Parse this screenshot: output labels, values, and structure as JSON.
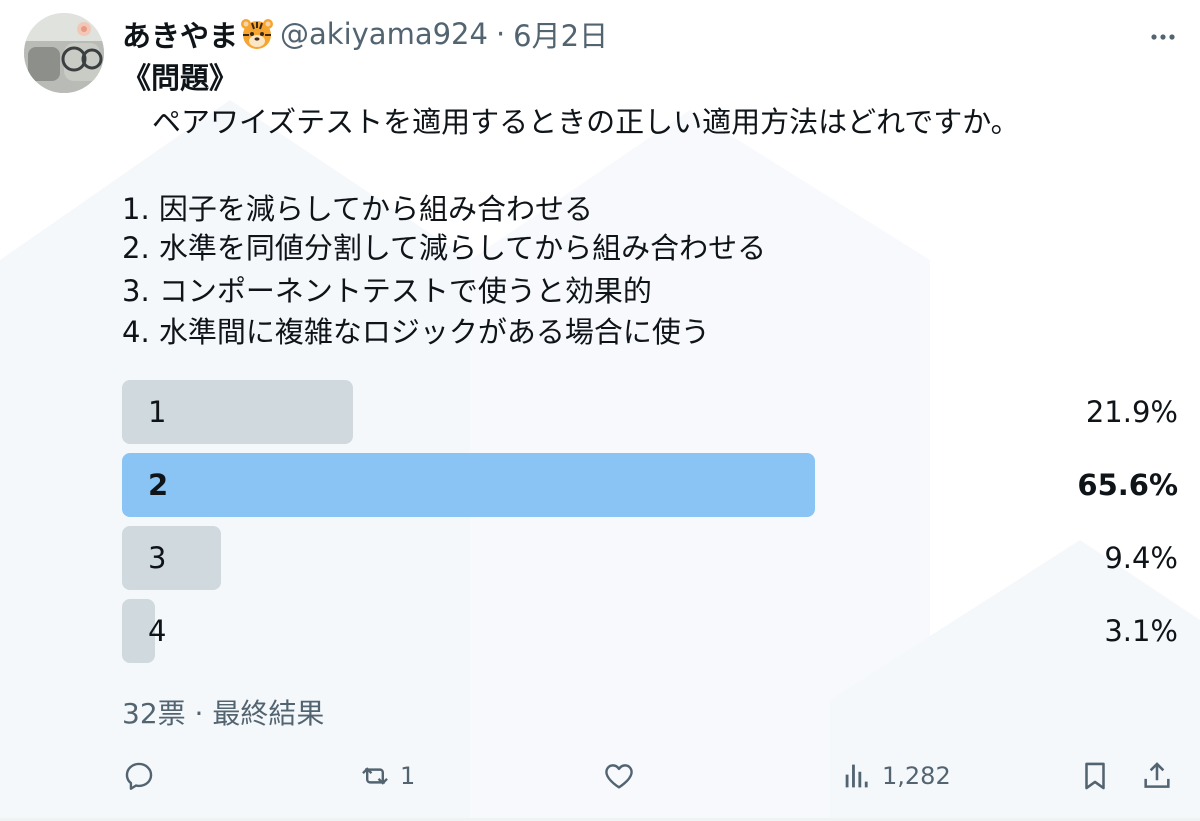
{
  "tweet": {
    "display_name": "あきやま",
    "emoji": "tiger",
    "handle": "@akiyama924",
    "separator": "·",
    "date": "6月2日",
    "heading": "《問題》",
    "question": "ペアワイズテストを適用するときの正しい適用方法はどれですか。",
    "choices": [
      "1. 因子を減らしてから組み合わせる",
      "2. 水準を同値分割して減らしてから組み合わせる",
      "3. コンポーネントテストで使うと効果的",
      "4. 水準間に複雑なロジックがある場合に使う"
    ]
  },
  "poll": {
    "options": [
      {
        "label": "1",
        "percent_text": "21.9%",
        "percent": 21.9,
        "winner": false
      },
      {
        "label": "2",
        "percent_text": "65.6%",
        "percent": 65.6,
        "winner": true
      },
      {
        "label": "3",
        "percent_text": "9.4%",
        "percent": 9.4,
        "winner": false
      },
      {
        "label": "4",
        "percent_text": "3.1%",
        "percent": 3.1,
        "winner": false
      }
    ],
    "summary": "32票 · 最終結果"
  },
  "actions": {
    "reply_icon": "reply-icon",
    "retweet_icon": "retweet-icon",
    "retweet_count": "1",
    "like_icon": "heart-icon",
    "views_icon": "analytics-icon",
    "views_count": "1,282",
    "bookmark_icon": "bookmark-icon",
    "share_icon": "share-icon"
  },
  "colors": {
    "text_primary": "#0f1419",
    "text_secondary": "#536471",
    "poll_bar": "#cfd9de",
    "poll_bar_winner": "#89c4f4"
  }
}
